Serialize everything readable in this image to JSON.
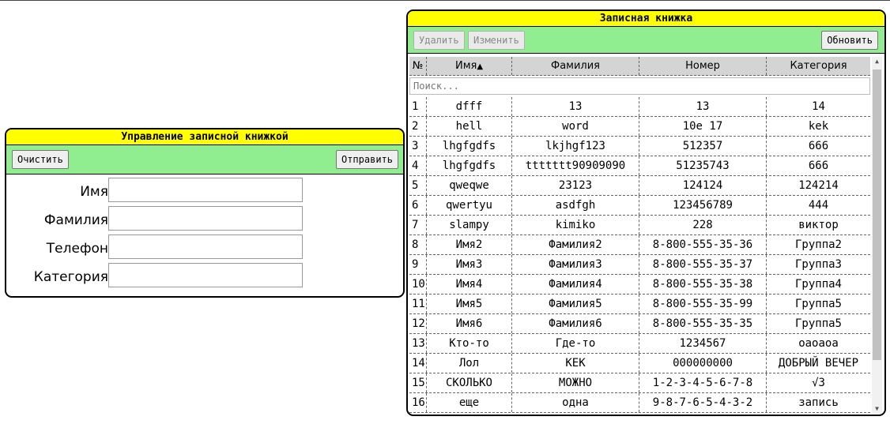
{
  "form_panel": {
    "title": "Управление записной книжкой",
    "clear_label": "Очистить",
    "submit_label": "Отправить",
    "fields": [
      {
        "label": "Имя",
        "value": ""
      },
      {
        "label": "Фамилия",
        "value": ""
      },
      {
        "label": "Телефон",
        "value": ""
      },
      {
        "label": "Категория",
        "value": ""
      }
    ]
  },
  "notebook": {
    "title": "Записная книжка",
    "delete_label": "Удалить",
    "edit_label": "Изменить",
    "refresh_label": "Обновить",
    "columns": [
      "№",
      "Имя",
      "Фамилия",
      "Номер",
      "Категория"
    ],
    "sort_indicator": "▲",
    "search_placeholder": "Поиск...",
    "rows": [
      [
        "1",
        "dfff",
        "13",
        "13",
        "14"
      ],
      [
        "2",
        "hell",
        "word",
        "10e 17",
        "kek"
      ],
      [
        "3",
        "lhgfgdfs",
        "lkjhgf123",
        "512357",
        "666"
      ],
      [
        "4",
        "lhgfgdfs",
        "ttttttt90909090",
        "51235743",
        "666"
      ],
      [
        "5",
        "qweqwe",
        "23123",
        "124124",
        "124214"
      ],
      [
        "6",
        "qwertyu",
        "asdfgh",
        "123456789",
        "444"
      ],
      [
        "7",
        "slampy",
        "kimiko",
        "228",
        "виктор"
      ],
      [
        "8",
        "Имя2",
        "Фамилия2",
        "8-800-555-35-36",
        "Группа2"
      ],
      [
        "9",
        "Имя3",
        "Фамилия3",
        "8-800-555-35-37",
        "Группа3"
      ],
      [
        "10",
        "Имя4",
        "Фамилия4",
        "8-800-555-35-38",
        "Группа4"
      ],
      [
        "11",
        "Имя5",
        "Фамилия5",
        "8-800-555-35-99",
        "Группа5"
      ],
      [
        "12",
        "Имя6",
        "Фамилия6",
        "8-800-555-35-35",
        "Группа5"
      ],
      [
        "13",
        "Кто-то",
        "Где-то",
        "1234567",
        "оаоаоа"
      ],
      [
        "14",
        "Лол",
        "KEK",
        "000000000",
        "ДОБРЫЙ ВЕЧЕР"
      ],
      [
        "15",
        "СКОЛЬКО",
        "МОЖНО",
        "1-2-3-4-5-6-7-8",
        "√3"
      ],
      [
        "16",
        "еще",
        "одна",
        "9-8-7-6-5-4-3-2",
        "запись"
      ]
    ]
  },
  "colors": {
    "title_bg": "#ffff00",
    "toolbar_bg": "#90ee90",
    "header_bg": "#d4d4d4"
  }
}
